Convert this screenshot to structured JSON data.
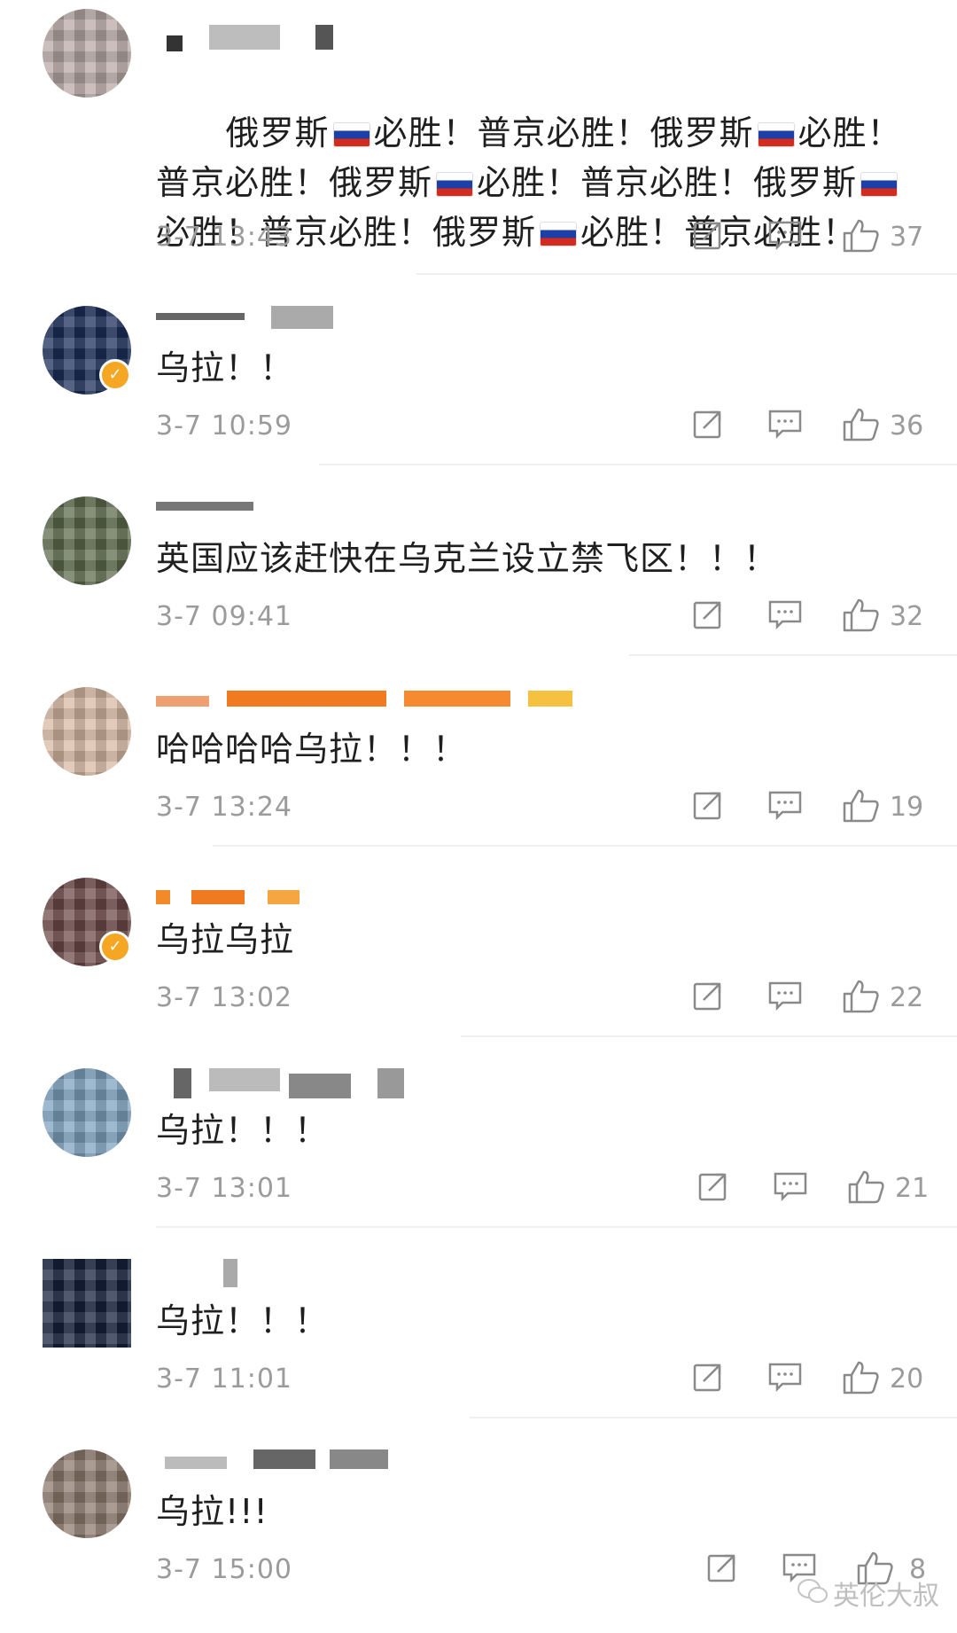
{
  "comments": [
    {
      "text_parts": [
        "俄罗斯",
        "flag",
        "必胜！普京必胜！俄罗斯",
        "flag",
        "必胜！普京必胜！俄罗斯",
        "flag",
        "必胜！普京必胜！俄罗斯",
        "flag",
        "必胜！普京必胜！俄罗斯",
        "flag",
        "必胜！普京必胜！"
      ],
      "time": "3-7 13:43",
      "likes": "37",
      "verified": false
    },
    {
      "text": "乌拉！！",
      "time": "3-7 10:59",
      "likes": "36",
      "verified": true
    },
    {
      "text": "英国应该赶快在乌克兰设立禁飞区！！！",
      "time": "3-7 09:41",
      "likes": "32",
      "verified": false
    },
    {
      "text": "哈哈哈哈乌拉！！！",
      "time": "3-7 13:24",
      "likes": "19",
      "verified": false
    },
    {
      "text": "乌拉乌拉",
      "time": "3-7 13:02",
      "likes": "22",
      "verified": true
    },
    {
      "text": "乌拉！！！",
      "time": "3-7 13:01",
      "likes": "21",
      "verified": false
    },
    {
      "text": "乌拉！！！",
      "time": "3-7 11:01",
      "likes": "20",
      "verified": false
    },
    {
      "text": "乌拉!!!",
      "time": "3-7 15:00",
      "likes": "8",
      "verified": false
    }
  ],
  "watermark": "英伦大叔",
  "icons": {
    "share": "share-icon",
    "reply": "comment-icon",
    "like": "thumbs-up-icon"
  },
  "colors": {
    "text": "#1f1f1f",
    "meta": "#9b9b9b",
    "divider": "#efefef",
    "verified": "#f5a623"
  }
}
